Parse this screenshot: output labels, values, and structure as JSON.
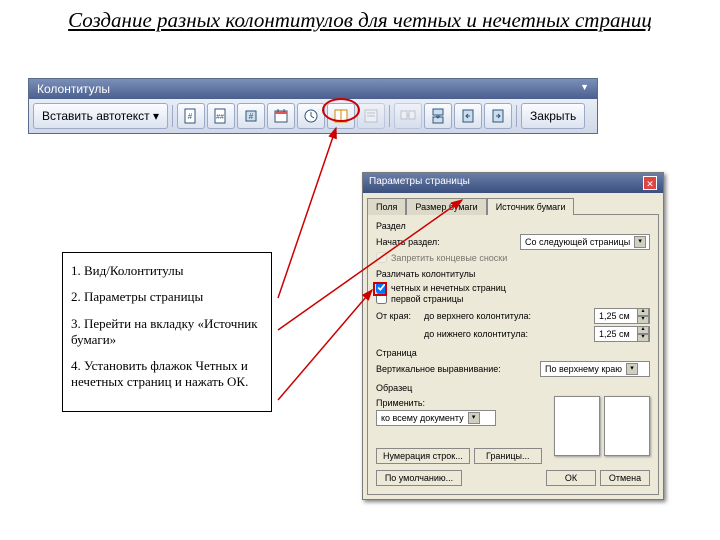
{
  "title": "Создание разных колонтитулов для четных и нечетных страниц",
  "toolbar": {
    "window_title": "Колонтитулы",
    "autotext": "Вставить автотекст ▾",
    "close": "Закрыть"
  },
  "instructions": {
    "s1": "1. Вид/Колонтитулы",
    "s2": "2. Параметры страницы",
    "s3": "3. Перейти на вкладку «Источник бумаги»",
    "s4": "4. Установить флажок Четных и нечетных страниц и нажать ОК."
  },
  "dialog": {
    "title": "Параметры страницы",
    "tabs": {
      "fields": "Поля",
      "paper": "Размер бумаги",
      "source": "Источник бумаги"
    },
    "section_lbl": "Раздел",
    "start_lbl": "Начать раздел:",
    "start_val": "Со следующей страницы",
    "suppress": "Запретить концевые сноски",
    "hf_lbl": "Различать колонтитулы",
    "cb_oddeven": "четных и нечетных страниц",
    "cb_first": "первой страницы",
    "from_edge": "От края:",
    "to_header": "до верхнего колонтитула:",
    "to_footer": "до нижнего колонтитула:",
    "dist_val": "1,25 см",
    "page_lbl": "Страница",
    "valign_lbl": "Вертикальное выравнивание:",
    "valign_val": "По верхнему краю",
    "sample_lbl": "Образец",
    "apply_lbl": "Применить:",
    "apply_val": "ко всему документу",
    "line_numbers": "Нумерация строк...",
    "borders": "Границы...",
    "default": "По умолчанию...",
    "ok": "ОК",
    "cancel": "Отмена"
  }
}
